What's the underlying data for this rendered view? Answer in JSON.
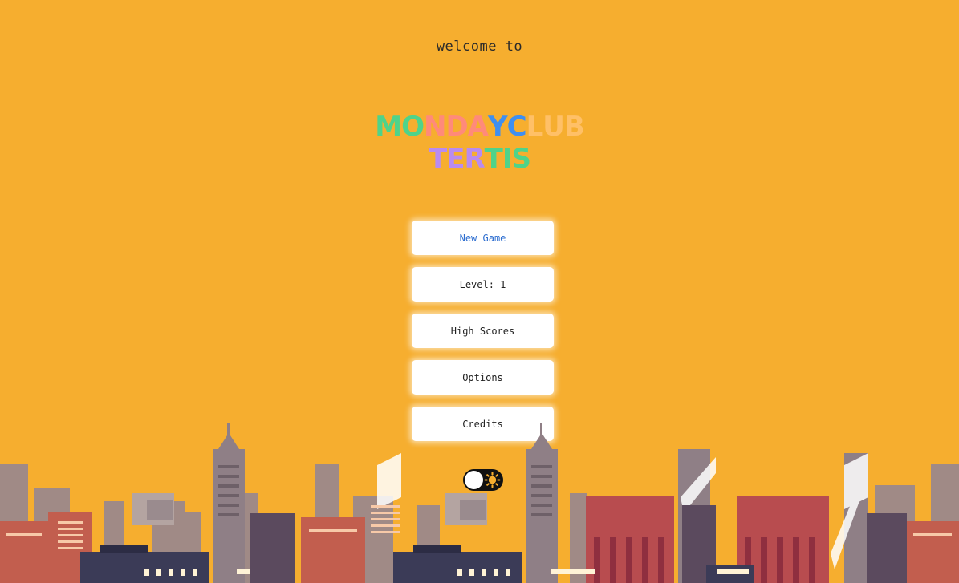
{
  "welcome_text": "welcome to",
  "logo": {
    "line1": [
      {
        "ch": "M",
        "color": "#4fd38a"
      },
      {
        "ch": "O",
        "color": "#4fd38a"
      },
      {
        "ch": "N",
        "color": "#ff8a7a"
      },
      {
        "ch": "D",
        "color": "#ff8a7a"
      },
      {
        "ch": "A",
        "color": "#ff8a7a"
      },
      {
        "ch": "Y",
        "color": "#3f8ff0"
      },
      {
        "ch": "C",
        "color": "#3f8ff0"
      },
      {
        "ch": "L",
        "color": "#ffc067"
      },
      {
        "ch": "U",
        "color": "#ffc067"
      },
      {
        "ch": "B",
        "color": "#ffc067"
      }
    ],
    "line2": [
      {
        "ch": "T",
        "color": "#b98bf0"
      },
      {
        "ch": "E",
        "color": "#b98bf0"
      },
      {
        "ch": "R",
        "color": "#b98bf0"
      },
      {
        "ch": "T",
        "color": "#4fd38a"
      },
      {
        "ch": "I",
        "color": "#4fd38a"
      },
      {
        "ch": "S",
        "color": "#4fd38a"
      }
    ]
  },
  "menu": {
    "new_game": "New Game",
    "level": "Level: 1",
    "high_scores": "High Scores",
    "options": "Options",
    "credits": "Credits"
  },
  "theme_toggle": {
    "icon": "sun-icon",
    "state": "light"
  },
  "colors": {
    "background": "#f6ae2f",
    "active_button_text": "#2f6fd0"
  }
}
